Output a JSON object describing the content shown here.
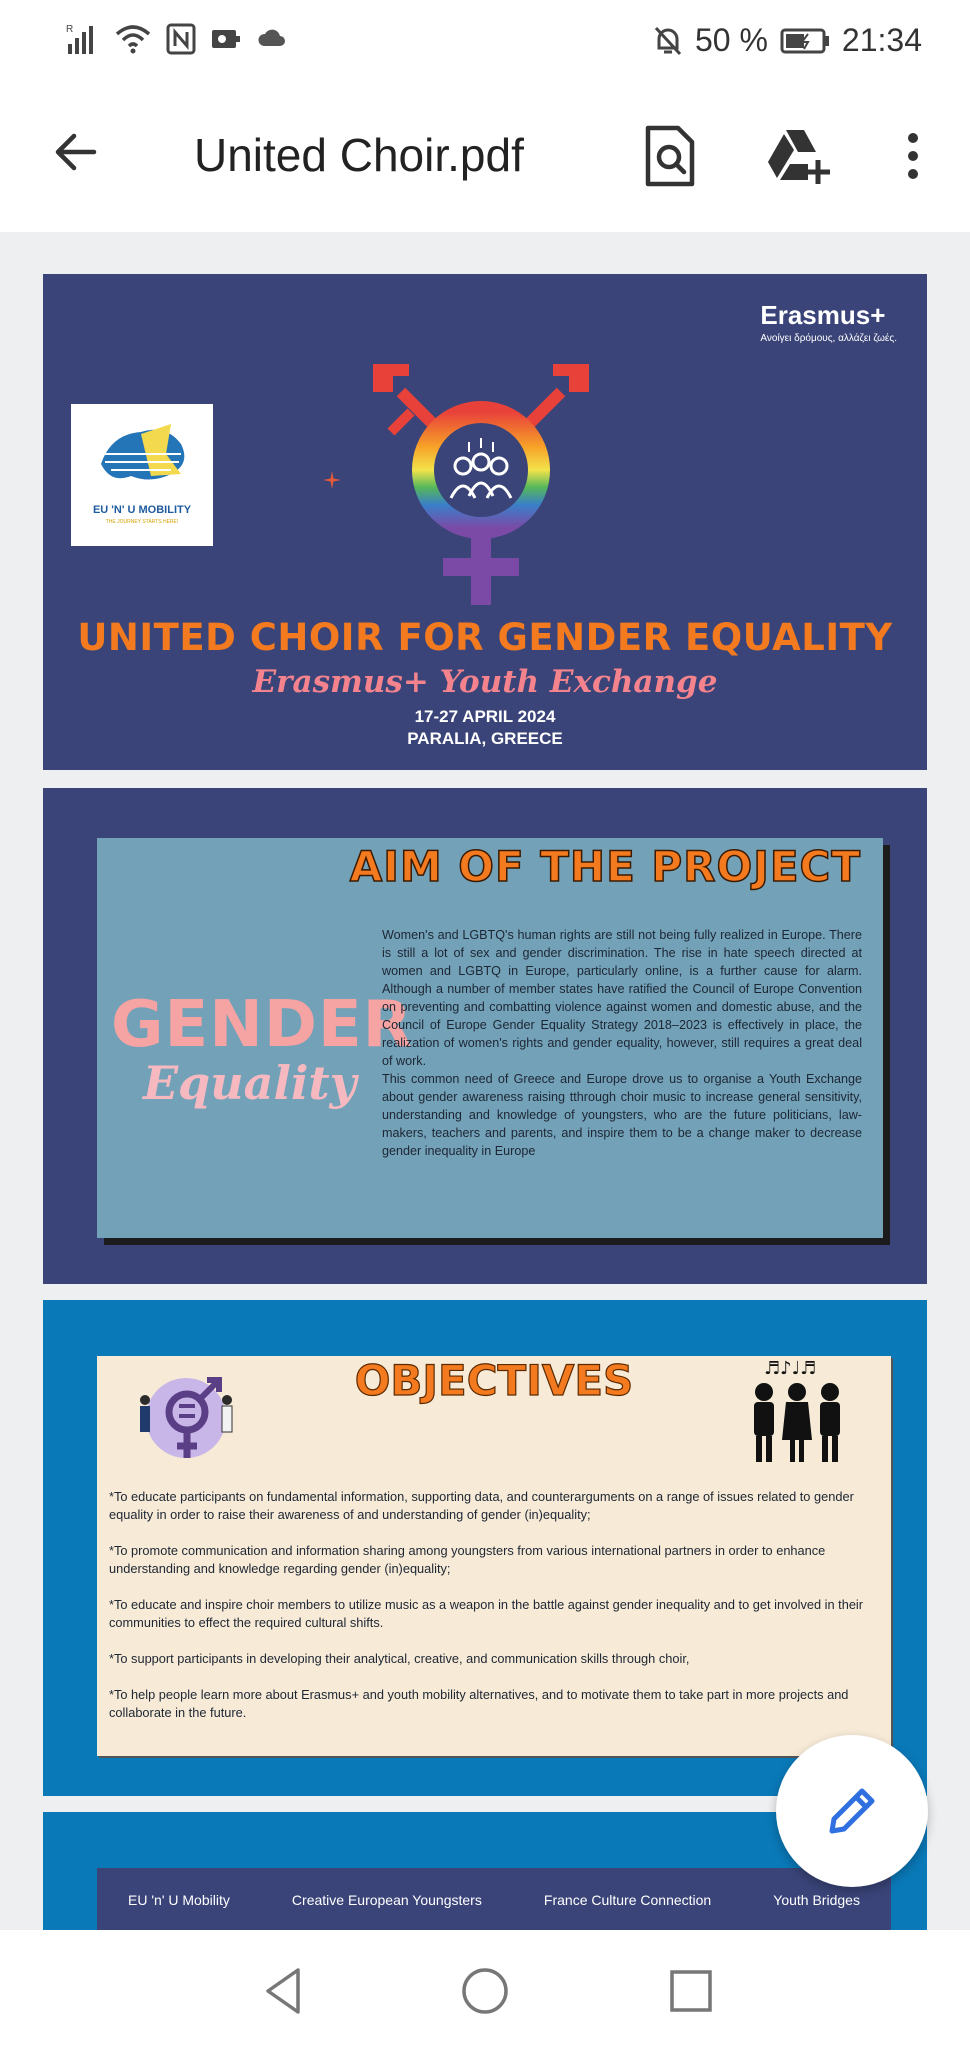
{
  "status_bar": {
    "battery": "50 %",
    "time": "21:34",
    "icons": [
      "signal-icon",
      "wifi-icon",
      "nfc-icon",
      "vpn-icon",
      "cloud-icon",
      "mute-icon",
      "battery-icon"
    ]
  },
  "app_bar": {
    "title": "United Choir.pdf",
    "icons": [
      "back-arrow-icon",
      "search-document-icon",
      "drive-add-icon",
      "more-vert-icon"
    ]
  },
  "colors": {
    "page_dark_blue": "#3a4478",
    "page_blue": "#0a79b8",
    "orange": "#f47a1f",
    "pink": "#f4838e",
    "fab_pen": "#2f6fe0"
  },
  "page1": {
    "erasmus_brand": "Erasmus+",
    "erasmus_sub": "Ανοίγει δρόμους, αλλάζει ζωές.",
    "logo_text": "EU 'N' U MOBILITY",
    "logo_tag": "THE JOURNEY STARTS HERE!",
    "headline": "UNITED CHOIR FOR GENDER EQUALITY",
    "subhead": "Erasmus+ Youth Exchange",
    "dates_line1": "17-27 APRIL 2024",
    "dates_line2": "PARALIA, GREECE"
  },
  "page2": {
    "title": "AIM OF THE PROJECT",
    "gender_word": "GENDER",
    "equality_word": "Equality",
    "body": " Women's and LGBTQ's  human rights are still not being fully realized in Europe. There is still a lot of sex and gender discrimination. The rise in hate speech directed at women and LGBTQ in Europe, particularly online, is a further cause for alarm.  Although a number of member states have ratified the Council of Europe Convention on preventing and combatting violence against women and domestic abuse, and the Council of Europe Gender Equality Strategy 2018–2023 is effectively in place, the realization of women's rights and gender equality, however, still requires a great deal of work.\nThis common need of Greece and Europe drove us to organise a Youth Exchange about gender awareness raising tthrough choir music to increase general sensitivity, understanding and knowledge of youngsters, who are the future politicians, law-makers, teachers and parents, and inspire them to be a change maker to decrease gender inequality in Europe"
  },
  "page3": {
    "title": "OBJECTIVES",
    "items": [
      "*To educate participants on fundamental information, supporting data, and counterarguments on a range of issues related to gender equality in order to raise their awareness of and understanding of gender (in)equality;",
      "*To promote communication and information sharing among youngsters from various international partners in order to enhance understanding and knowledge regarding gender (in)equality;",
      "*To educate and inspire choir members to utilize music as a weapon in the battle against gender inequality and to get involved in their communities to effect the required cultural shifts.",
      "*To support participants in developing their analytical, creative, and communication skills through choir,",
      "*To help people learn more about Erasmus+ and youth mobility alternatives, and to motivate them to take part in more projects and collaborate in the future."
    ]
  },
  "page4": {
    "partners": [
      "EU 'n' U Mobility",
      "Creative European Youngsters",
      "France Culture Connection",
      "Youth Bridges"
    ]
  },
  "fab": {
    "icon": "edit-pencil-icon"
  },
  "nav_bar": {
    "icons": [
      "nav-back-icon",
      "nav-home-icon",
      "nav-recents-icon"
    ]
  }
}
